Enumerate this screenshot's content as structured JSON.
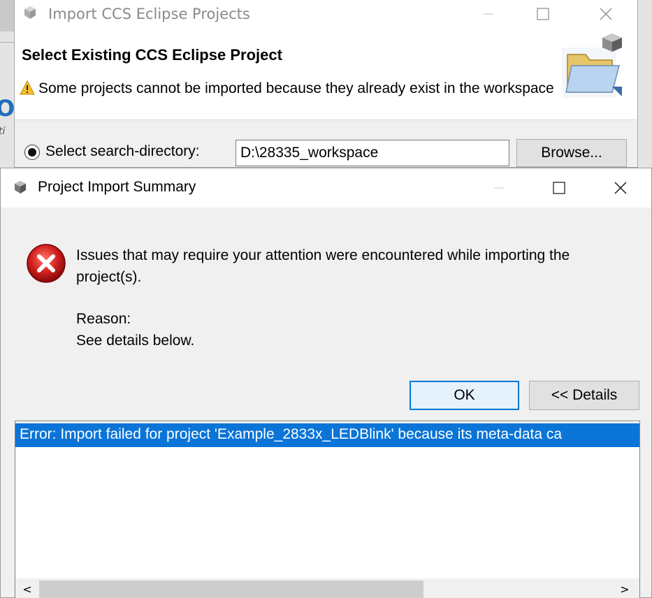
{
  "background_window": {
    "fragment_big": "O",
    "fragment_small": "ti"
  },
  "import_dialog": {
    "title": "Import CCS Eclipse Projects",
    "header": "Select Existing CCS Eclipse Project",
    "warning": "Some projects cannot be imported because they already exist in the workspace",
    "radio_label": "Select search-directory:",
    "directory_value": "D:\\28335_workspace",
    "browse_label": "Browse..."
  },
  "summary_dialog": {
    "title": "Project Import Summary",
    "message": "Issues that may require your attention were encountered while importing the project(s).",
    "reason_label": "Reason:",
    "reason_text": "See details below.",
    "ok_label": "OK",
    "details_label": "<< Details",
    "detail_rows": [
      "Error: Import failed for project 'Example_2833x_LEDBlink' because its meta-data ca"
    ],
    "scroll_left": "<",
    "scroll_right": ">"
  },
  "colors": {
    "selection": "#0a74d7",
    "default_button_border": "#0078d7",
    "error_red": "#d01f1f",
    "warning_yellow": "#f6c02c"
  },
  "icons": [
    "app-cube-icon",
    "minimize-icon",
    "maximize-icon",
    "close-icon",
    "warning-icon",
    "folder-icon",
    "error-icon",
    "scroll-left-icon",
    "scroll-right-icon"
  ]
}
